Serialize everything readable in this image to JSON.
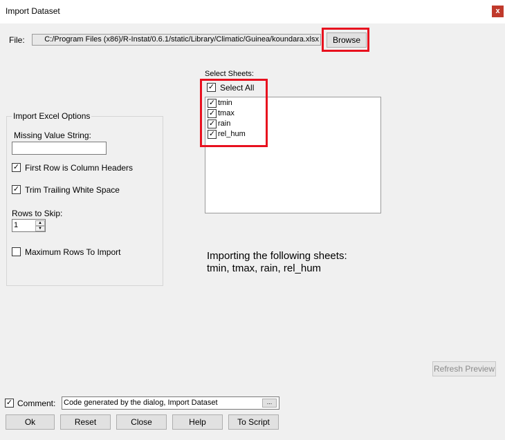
{
  "window": {
    "title": "Import Dataset",
    "close_glyph": "x"
  },
  "file": {
    "label": "File:",
    "path": "C:/Program Files (x86)/R-Instat/0.6.1/static/Library/Climatic/Guinea/koundara.xlsx",
    "browse_label": "Browse"
  },
  "sheets": {
    "label": "Select Sheets:",
    "select_all_label": "Select All",
    "select_all_checked": true,
    "items": [
      {
        "name": "tmin",
        "checked": true
      },
      {
        "name": "tmax",
        "checked": true
      },
      {
        "name": "rain",
        "checked": true
      },
      {
        "name": "rel_hum",
        "checked": true
      }
    ]
  },
  "options": {
    "title": "Import Excel Options",
    "missing_value_label": "Missing Value String:",
    "missing_value": "",
    "first_row_headers_label": "First Row is Column Headers",
    "first_row_headers_checked": true,
    "trim_whitespace_label": "Trim Trailing White Space",
    "trim_whitespace_checked": true,
    "rows_to_skip_label": "Rows to Skip:",
    "rows_to_skip": "1",
    "max_rows_label": "Maximum Rows To Import",
    "max_rows_checked": false
  },
  "import_info": {
    "line1": "Importing the following sheets:",
    "line2": "tmin, tmax, rain, rel_hum"
  },
  "preview": {
    "refresh_label": "Refresh Preview"
  },
  "comment": {
    "label": "Comment:",
    "checked": true,
    "value": "Code generated by the dialog, Import Dataset",
    "ellipsis": "..."
  },
  "buttons": {
    "ok": "Ok",
    "reset": "Reset",
    "close": "Close",
    "help": "Help",
    "to_script": "To Script"
  },
  "check_glyph": "✓",
  "colors": {
    "highlight": "#e8101e",
    "close_button": "#c0392b"
  }
}
